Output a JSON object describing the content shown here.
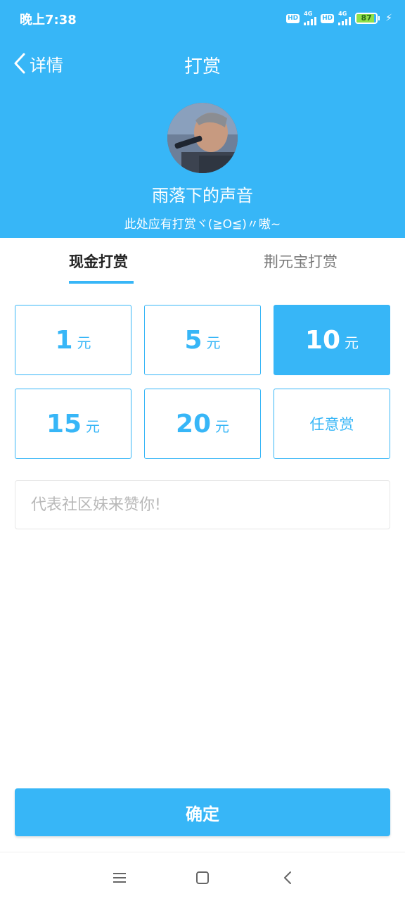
{
  "status_bar": {
    "time": "晚上7:38",
    "hd_badge": "HD",
    "network": "4G",
    "battery": "87",
    "battery_level": 0.87
  },
  "nav": {
    "back_label": "详情",
    "title": "打赏"
  },
  "profile": {
    "username": "雨落下的声音",
    "subtitle": "此处应有打赏ヾ(≧O≦)〃嗷~"
  },
  "tabs": [
    {
      "label": "现金打赏",
      "active": true
    },
    {
      "label": "荆元宝打赏",
      "active": false
    }
  ],
  "amounts": [
    {
      "value": "1",
      "unit": "元",
      "selected": false
    },
    {
      "value": "5",
      "unit": "元",
      "selected": false
    },
    {
      "value": "10",
      "unit": "元",
      "selected": true
    },
    {
      "value": "15",
      "unit": "元",
      "selected": false
    },
    {
      "value": "20",
      "unit": "元",
      "selected": false
    }
  ],
  "custom_amount_label": "任意赏",
  "message": {
    "placeholder": "代表社区妹来赞你!",
    "value": ""
  },
  "confirm_label": "确定",
  "colors": {
    "accent": "#37b6f7",
    "battery": "#8ee04a"
  }
}
